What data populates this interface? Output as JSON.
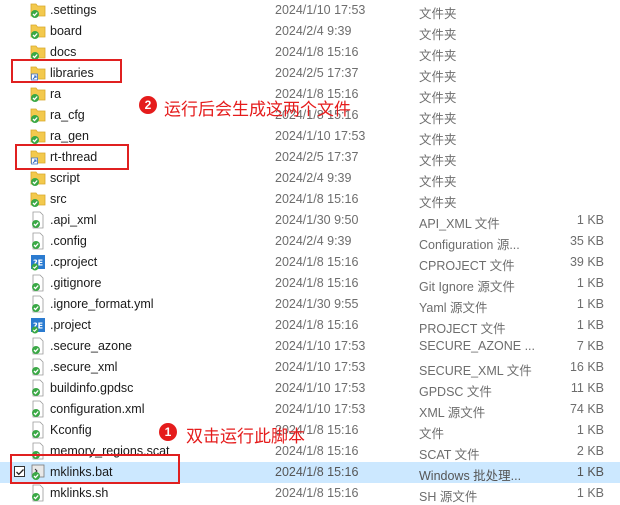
{
  "files": [
    {
      "name": ".settings",
      "date": "2024/1/10 17:53",
      "type": "文件夹",
      "size": "",
      "icon": "folder-synced-icon"
    },
    {
      "name": "board",
      "date": "2024/2/4 9:39",
      "type": "文件夹",
      "size": "",
      "icon": "folder-synced-icon"
    },
    {
      "name": "docs",
      "date": "2024/1/8 15:16",
      "type": "文件夹",
      "size": "",
      "icon": "folder-synced-icon"
    },
    {
      "name": "libraries",
      "date": "2024/2/5 17:37",
      "type": "文件夹",
      "size": "",
      "icon": "folder-link-icon"
    },
    {
      "name": "ra",
      "date": "2024/1/8 15:16",
      "type": "文件夹",
      "size": "",
      "icon": "folder-synced-icon"
    },
    {
      "name": "ra_cfg",
      "date": "2024/1/8 15:16",
      "type": "文件夹",
      "size": "",
      "icon": "folder-synced-icon"
    },
    {
      "name": "ra_gen",
      "date": "2024/1/10 17:53",
      "type": "文件夹",
      "size": "",
      "icon": "folder-synced-icon"
    },
    {
      "name": "rt-thread",
      "date": "2024/2/5 17:37",
      "type": "文件夹",
      "size": "",
      "icon": "folder-link-icon"
    },
    {
      "name": "script",
      "date": "2024/2/4 9:39",
      "type": "文件夹",
      "size": "",
      "icon": "folder-synced-icon"
    },
    {
      "name": "src",
      "date": "2024/1/8 15:16",
      "type": "文件夹",
      "size": "",
      "icon": "folder-synced-icon"
    },
    {
      "name": ".api_xml",
      "date": "2024/1/30 9:50",
      "type": "API_XML 文件",
      "size": "1 KB",
      "icon": "file-synced-icon"
    },
    {
      "name": ".config",
      "date": "2024/2/4 9:39",
      "type": "Configuration 源...",
      "size": "35 KB",
      "icon": "file-synced-icon"
    },
    {
      "name": ".cproject",
      "date": "2024/1/8 15:16",
      "type": "CPROJECT 文件",
      "size": "39 KB",
      "icon": "eclipse-file-icon"
    },
    {
      "name": ".gitignore",
      "date": "2024/1/8 15:16",
      "type": "Git Ignore 源文件",
      "size": "1 KB",
      "icon": "file-synced-icon"
    },
    {
      "name": ".ignore_format.yml",
      "date": "2024/1/30 9:55",
      "type": "Yaml 源文件",
      "size": "1 KB",
      "icon": "file-synced-icon"
    },
    {
      "name": ".project",
      "date": "2024/1/8 15:16",
      "type": "PROJECT 文件",
      "size": "1 KB",
      "icon": "eclipse-file-icon"
    },
    {
      "name": ".secure_azone",
      "date": "2024/1/10 17:53",
      "type": "SECURE_AZONE ...",
      "size": "7 KB",
      "icon": "file-synced-icon"
    },
    {
      "name": ".secure_xml",
      "date": "2024/1/10 17:53",
      "type": "SECURE_XML 文件",
      "size": "16 KB",
      "icon": "file-synced-icon"
    },
    {
      "name": "buildinfo.gpdsc",
      "date": "2024/1/10 17:53",
      "type": "GPDSC 文件",
      "size": "11 KB",
      "icon": "file-synced-icon"
    },
    {
      "name": "configuration.xml",
      "date": "2024/1/10 17:53",
      "type": "XML 源文件",
      "size": "74 KB",
      "icon": "file-synced-icon"
    },
    {
      "name": "Kconfig",
      "date": "2024/1/8 15:16",
      "type": "文件",
      "size": "1 KB",
      "icon": "file-synced-icon"
    },
    {
      "name": "memory_regions.scat",
      "date": "2024/1/8 15:16",
      "type": "SCAT 文件",
      "size": "2 KB",
      "icon": "file-synced-icon"
    },
    {
      "name": "mklinks.bat",
      "date": "2024/1/8 15:16",
      "type": "Windows 批处理...",
      "size": "1 KB",
      "icon": "batch-file-icon",
      "selected": true
    },
    {
      "name": "mklinks.sh",
      "date": "2024/1/8 15:16",
      "type": "SH 源文件",
      "size": "1 KB",
      "icon": "file-synced-icon"
    }
  ],
  "annotations": {
    "note1_number": "1",
    "note1_text": "双击运行此脚本",
    "note2_number": "2",
    "note2_text": "运行后会生成这两个文件"
  },
  "colors": {
    "annotation_red": "#e51c1c",
    "selection": "#cce8ff",
    "sync_green": "#3aa845",
    "folder_yellow": "#f3c94d"
  }
}
